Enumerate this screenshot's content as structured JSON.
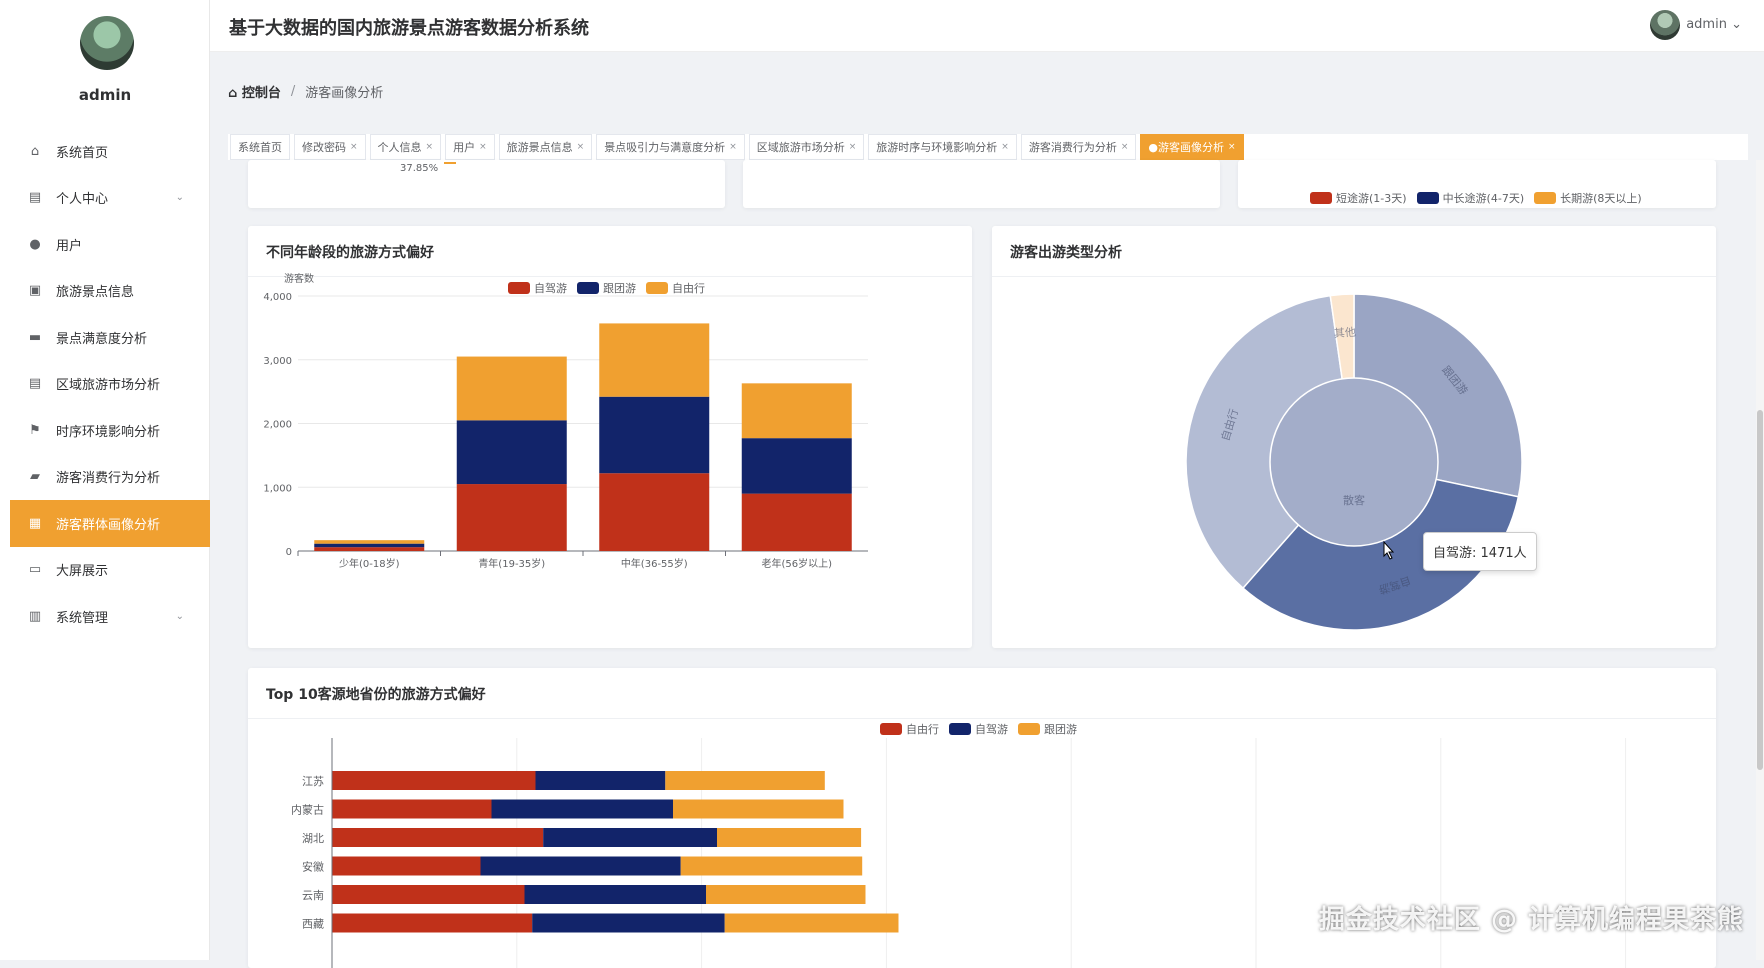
{
  "header": {
    "title": "基于大数据的国内旅游景点游客数据分析系统",
    "user": "admin"
  },
  "sidebar": {
    "user": "admin",
    "items": [
      {
        "label": "系统首页",
        "icon": "home-icon",
        "glyph": "⌂"
      },
      {
        "label": "个人中心",
        "icon": "id-card-icon",
        "glyph": "▤",
        "expand": true
      },
      {
        "label": "用户",
        "icon": "location-pin-icon",
        "glyph": "●"
      },
      {
        "label": "旅游景点信息",
        "icon": "box-icon",
        "glyph": "▣"
      },
      {
        "label": "景点满意度分析",
        "icon": "briefcase-icon",
        "glyph": "▬"
      },
      {
        "label": "区域旅游市场分析",
        "icon": "clipboard-icon",
        "glyph": "▤"
      },
      {
        "label": "时序环境影响分析",
        "icon": "flag-icon",
        "glyph": "⚑"
      },
      {
        "label": "游客消费行为分析",
        "icon": "ticket-icon",
        "glyph": "▰"
      },
      {
        "label": "游客群体画像分析",
        "icon": "grid-icon",
        "glyph": "▦",
        "active": true
      },
      {
        "label": "大屏展示",
        "icon": "monitor-icon",
        "glyph": "▭"
      },
      {
        "label": "系统管理",
        "icon": "bar-chart-icon",
        "glyph": "▥",
        "expand": true
      }
    ]
  },
  "breadcrumb": {
    "home": "控制台",
    "separator": "/",
    "current": "游客画像分析"
  },
  "tags": [
    {
      "label": "系统首页",
      "closable": false
    },
    {
      "label": "修改密码",
      "closable": true
    },
    {
      "label": "个人信息",
      "closable": true
    },
    {
      "label": "用户",
      "closable": true
    },
    {
      "label": "旅游景点信息",
      "closable": true
    },
    {
      "label": "景点吸引力与满意度分析",
      "closable": true
    },
    {
      "label": "区域旅游市场分析",
      "closable": true
    },
    {
      "label": "旅游时序与环境影响分析",
      "closable": true
    },
    {
      "label": "游客消费行为分析",
      "closable": true
    },
    {
      "label": "●游客画像分析",
      "closable": true,
      "active": true
    }
  ],
  "top_partial": {
    "pct_label": "37.85%",
    "legend": [
      {
        "name": "短途游(1-3天)",
        "color": "#c0311a"
      },
      {
        "name": "中长途游(4-7天)",
        "color": "#12246a"
      },
      {
        "name": "长期游(8天以上)",
        "color": "#f0a030"
      }
    ]
  },
  "colors": {
    "red": "#c0311a",
    "navy": "#12246a",
    "orange": "#f0a030",
    "accent": "#f0a030"
  },
  "chart_data": [
    {
      "title": "不同年龄段的旅游方式偏好",
      "type": "bar",
      "stacked": true,
      "ylabel": "游客数",
      "ylim": [
        0,
        4000
      ],
      "yticks": [
        "0",
        "1,000",
        "2,000",
        "3,000",
        "4,000"
      ],
      "categories": [
        "少年(0-18岁)",
        "青年(19-35岁)",
        "中年(36-55岁)",
        "老年(56岁以上)"
      ],
      "series": [
        {
          "name": "自驾游",
          "color": "#c0311a",
          "values": [
            60,
            1050,
            1220,
            900
          ]
        },
        {
          "name": "跟团游",
          "color": "#12246a",
          "values": [
            55,
            1000,
            1200,
            870
          ]
        },
        {
          "name": "自由行",
          "color": "#f0a030",
          "values": [
            55,
            1000,
            1150,
            860
          ]
        }
      ],
      "legend_position": "top"
    },
    {
      "title": "游客出游类型分析",
      "type": "pie",
      "inner": {
        "label": "散客"
      },
      "slices": [
        {
          "name": "跟团游",
          "value": 1256
        },
        {
          "name": "自驾游",
          "value": 1471
        },
        {
          "name": "自由行",
          "value": 1608
        },
        {
          "name": "其他",
          "value": 100
        }
      ],
      "tooltip": "自驾游: 1471人"
    },
    {
      "title": "Top 10客源地省份的旅游方式偏好",
      "type": "bar",
      "orientation": "horizontal",
      "stacked": true,
      "categories": [
        "江苏",
        "内蒙古",
        "湖北",
        "安徽",
        "云南",
        "西藏"
      ],
      "series": [
        {
          "name": "自由行",
          "color": "#c0311a",
          "values": [
            185,
            145,
            192,
            135,
            175,
            182
          ]
        },
        {
          "name": "自驾游",
          "color": "#12246a",
          "values": [
            118,
            165,
            158,
            182,
            165,
            175
          ]
        },
        {
          "name": "跟团游",
          "color": "#f0a030",
          "values": [
            145,
            155,
            131,
            165,
            145,
            158
          ]
        }
      ],
      "legend_position": "top"
    }
  ],
  "watermark": "掘金技术社区 @ 计算机编程果茶熊"
}
